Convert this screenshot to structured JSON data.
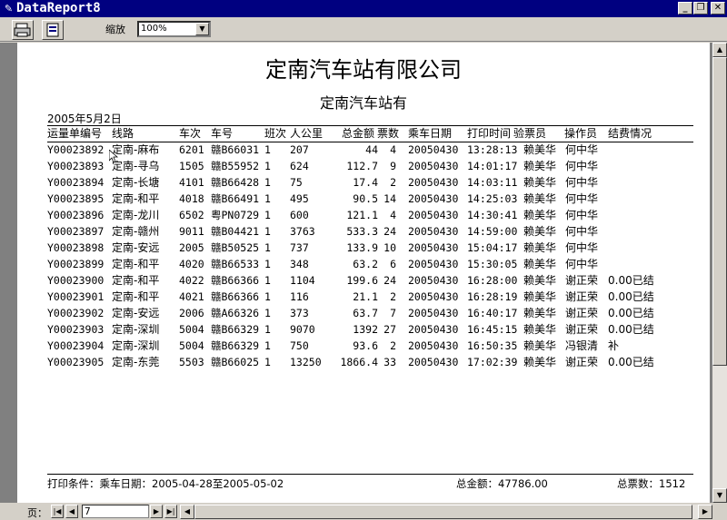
{
  "window": {
    "title": "DataReport8"
  },
  "toolbar": {
    "zoom_label": "缩放",
    "zoom_value": "100%"
  },
  "report": {
    "title": "定南汽车站有限公司",
    "subtitle": "定南汽车站有",
    "date": "2005年5月2日",
    "columns": [
      "运量单编号",
      "线路",
      "车次",
      "车号",
      "班次",
      "人公里",
      "总金额",
      "票数",
      "乘车日期",
      "打印时间",
      "验票员",
      "操作员",
      "结费情况"
    ],
    "rows": [
      [
        "Y00023892",
        "定南-麻布",
        "6201",
        "赣B66031",
        "1",
        "207",
        "44",
        "4",
        "20050430",
        "13:28:13",
        "赖美华",
        "何中华",
        ""
      ],
      [
        "Y00023893",
        "定南-寻乌",
        "1505",
        "赣B55952",
        "1",
        "624",
        "112.7",
        "9",
        "20050430",
        "14:01:17",
        "赖美华",
        "何中华",
        ""
      ],
      [
        "Y00023894",
        "定南-长塘",
        "4101",
        "赣B66428",
        "1",
        "75",
        "17.4",
        "2",
        "20050430",
        "14:03:11",
        "赖美华",
        "何中华",
        ""
      ],
      [
        "Y00023895",
        "定南-和平",
        "4018",
        "赣B66491",
        "1",
        "495",
        "90.5",
        "14",
        "20050430",
        "14:25:03",
        "赖美华",
        "何中华",
        ""
      ],
      [
        "Y00023896",
        "定南-龙川",
        "6502",
        "粤PN0729",
        "1",
        "600",
        "121.1",
        "4",
        "20050430",
        "14:30:41",
        "赖美华",
        "何中华",
        ""
      ],
      [
        "Y00023897",
        "定南-赣州",
        "9011",
        "赣B04421",
        "1",
        "3763",
        "533.3",
        "24",
        "20050430",
        "14:59:00",
        "赖美华",
        "何中华",
        ""
      ],
      [
        "Y00023898",
        "定南-安远",
        "2005",
        "赣B50525",
        "1",
        "737",
        "133.9",
        "10",
        "20050430",
        "15:04:17",
        "赖美华",
        "何中华",
        ""
      ],
      [
        "Y00023899",
        "定南-和平",
        "4020",
        "赣B66533",
        "1",
        "348",
        "63.2",
        "6",
        "20050430",
        "15:30:05",
        "赖美华",
        "何中华",
        ""
      ],
      [
        "Y00023900",
        "定南-和平",
        "4022",
        "赣B66366",
        "1",
        "1104",
        "199.6",
        "24",
        "20050430",
        "16:28:00",
        "赖美华",
        "谢正荣",
        "0.00已结"
      ],
      [
        "Y00023901",
        "定南-和平",
        "4021",
        "赣B66366",
        "1",
        "116",
        "21.1",
        "2",
        "20050430",
        "16:28:19",
        "赖美华",
        "谢正荣",
        "0.00已结"
      ],
      [
        "Y00023902",
        "定南-安远",
        "2006",
        "赣A66326",
        "1",
        "373",
        "63.7",
        "7",
        "20050430",
        "16:40:17",
        "赖美华",
        "谢正荣",
        "0.00已结"
      ],
      [
        "Y00023903",
        "定南-深圳",
        "5004",
        "赣B66329",
        "1",
        "9070",
        "1392",
        "27",
        "20050430",
        "16:45:15",
        "赖美华",
        "谢正荣",
        "0.00已结"
      ],
      [
        "Y00023904",
        "定南-深圳",
        "5004",
        "赣B66329",
        "1",
        "750",
        "93.6",
        "2",
        "20050430",
        "16:50:35",
        "赖美华",
        "冯银清",
        "补"
      ],
      [
        "Y00023905",
        "定南-东莞",
        "5503",
        "赣B66025",
        "1",
        "13250",
        "1866.4",
        "33",
        "20050430",
        "17:02:39",
        "赖美华",
        "谢正荣",
        "0.00已结"
      ]
    ],
    "footer": {
      "condition": "打印条件：乘车日期：2005-04-28至2005-05-02",
      "total_amount": "总金额：47786.00",
      "total_tickets": "总票数：1512"
    }
  },
  "statusbar": {
    "page_label": "页：",
    "page_value": "7"
  }
}
